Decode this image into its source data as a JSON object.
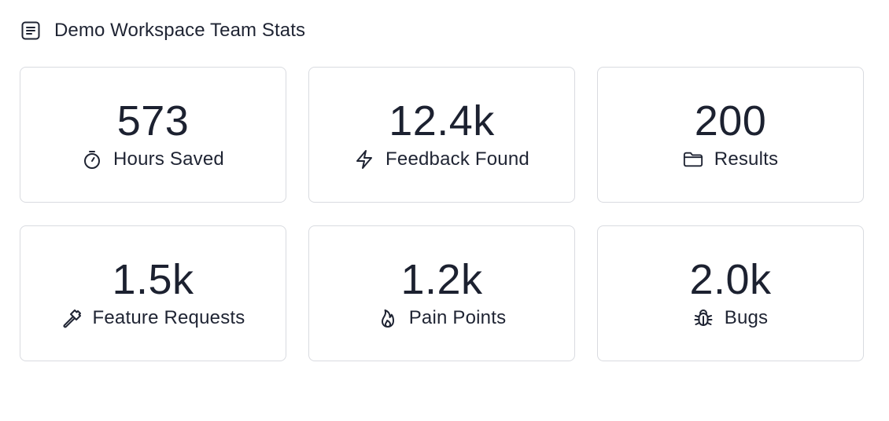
{
  "header": {
    "title": "Demo Workspace Team Stats",
    "icon": "document-list-icon"
  },
  "stats": [
    {
      "value": "573",
      "label": "Hours Saved",
      "icon": "stopwatch-icon"
    },
    {
      "value": "12.4k",
      "label": "Feedback Found",
      "icon": "lightning-icon"
    },
    {
      "value": "200",
      "label": "Results",
      "icon": "folder-icon"
    },
    {
      "value": "1.5k",
      "label": "Feature Requests",
      "icon": "hammer-icon"
    },
    {
      "value": "1.2k",
      "label": "Pain Points",
      "icon": "flame-icon"
    },
    {
      "value": "2.0k",
      "label": "Bugs",
      "icon": "bug-icon"
    }
  ],
  "colors": {
    "text": "#1f2433",
    "border": "#d9dbe0",
    "background": "#ffffff"
  }
}
